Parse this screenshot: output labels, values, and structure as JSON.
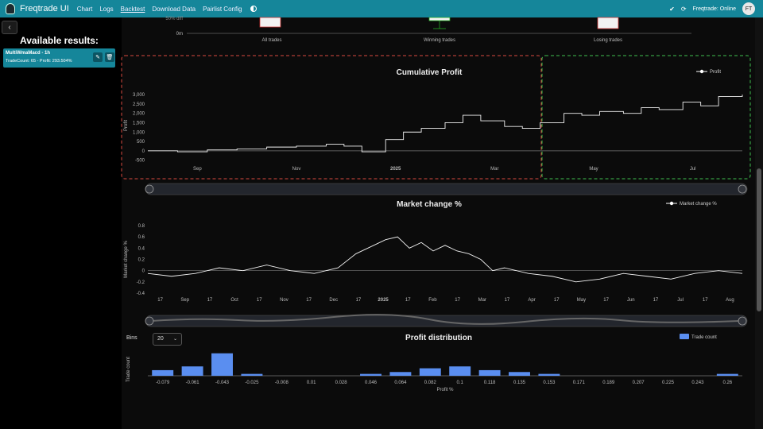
{
  "nav": {
    "brand": "Freqtrade UI",
    "links": [
      "Chart",
      "Logs",
      "Backtest",
      "Download Data",
      "Pairlist Config"
    ],
    "active": "Backtest",
    "status": "Freqtrade: Online",
    "avatar": "FT"
  },
  "sidebar": {
    "heading": "Available results:",
    "result": {
      "name": "MultiWmaMacd - 1h",
      "info": "TradeCount: 65 - Profit: 293.504%"
    }
  },
  "top_chart": {
    "y_label": "50% diff",
    "y_zero": "0m",
    "categories": [
      "All trades",
      "Winning trades",
      "Losing trades"
    ]
  },
  "chart_data": [
    {
      "type": "line",
      "title": "Cumulative Profit",
      "legend": "Profit",
      "ylabel": "Profit",
      "yticks": [
        -500,
        0,
        500,
        1000,
        1500,
        2000,
        2500,
        3000
      ],
      "ylim": [
        -600,
        3300
      ],
      "xticks": [
        "Sep",
        "Nov",
        "2025",
        "Mar",
        "May",
        "Jul"
      ],
      "x": [
        0,
        0.05,
        0.1,
        0.15,
        0.2,
        0.25,
        0.3,
        0.33,
        0.36,
        0.4,
        0.43,
        0.46,
        0.5,
        0.53,
        0.56,
        0.6,
        0.63,
        0.66,
        0.7,
        0.73,
        0.76,
        0.8,
        0.83,
        0.86,
        0.9,
        0.93,
        0.96,
        1.0
      ],
      "values": [
        0,
        -50,
        50,
        100,
        200,
        250,
        350,
        250,
        -50,
        600,
        1000,
        1200,
        1500,
        1900,
        1600,
        1300,
        1200,
        1500,
        2000,
        1900,
        2100,
        2000,
        2300,
        2200,
        2600,
        2400,
        2900,
        3000
      ]
    },
    {
      "type": "line",
      "title": "Market change %",
      "legend": "Market change %",
      "ylabel": "Market change %",
      "yticks": [
        -0.4,
        -0.2,
        0,
        0.2,
        0.4,
        0.6,
        0.8
      ],
      "ylim": [
        -0.4,
        0.8
      ],
      "xticks": [
        "17",
        "Sep",
        "17",
        "Oct",
        "17",
        "Nov",
        "17",
        "Dec",
        "17",
        "2025",
        "17",
        "Feb",
        "17",
        "Mar",
        "17",
        "Apr",
        "17",
        "May",
        "17",
        "Jun",
        "17",
        "Jul",
        "17",
        "Aug"
      ],
      "x": [
        0,
        0.04,
        0.08,
        0.12,
        0.16,
        0.2,
        0.24,
        0.28,
        0.32,
        0.35,
        0.38,
        0.4,
        0.42,
        0.44,
        0.46,
        0.48,
        0.5,
        0.52,
        0.54,
        0.56,
        0.58,
        0.6,
        0.64,
        0.68,
        0.72,
        0.76,
        0.8,
        0.84,
        0.88,
        0.92,
        0.96,
        1.0
      ],
      "values": [
        -0.05,
        -0.1,
        -0.05,
        0.05,
        0.0,
        0.1,
        0.0,
        -0.05,
        0.05,
        0.3,
        0.45,
        0.55,
        0.6,
        0.4,
        0.5,
        0.35,
        0.45,
        0.35,
        0.3,
        0.2,
        0.0,
        0.05,
        -0.05,
        -0.1,
        -0.2,
        -0.15,
        -0.05,
        -0.1,
        -0.15,
        -0.05,
        0.0,
        -0.05
      ]
    },
    {
      "type": "bar",
      "title": "Profit distribution",
      "legend": "Trade count",
      "ylabel": "Trade count",
      "xlabel": "Profit %",
      "categories": [
        "-0.079",
        "-0.061",
        "-0.043",
        "-0.025",
        "-0.008",
        "0.01",
        "0.028",
        "0.046",
        "0.064",
        "0.082",
        "0.1",
        "0.118",
        "0.135",
        "0.153",
        "0.171",
        "0.189",
        "0.207",
        "0.225",
        "0.243",
        "0.26"
      ],
      "values": [
        3,
        5,
        12,
        1,
        0,
        0,
        0,
        1,
        2,
        4,
        5,
        3,
        2,
        1,
        0,
        0,
        0,
        0,
        0,
        1
      ],
      "ymax": 14
    }
  ],
  "bins": {
    "label": "Bins",
    "value": "20"
  }
}
